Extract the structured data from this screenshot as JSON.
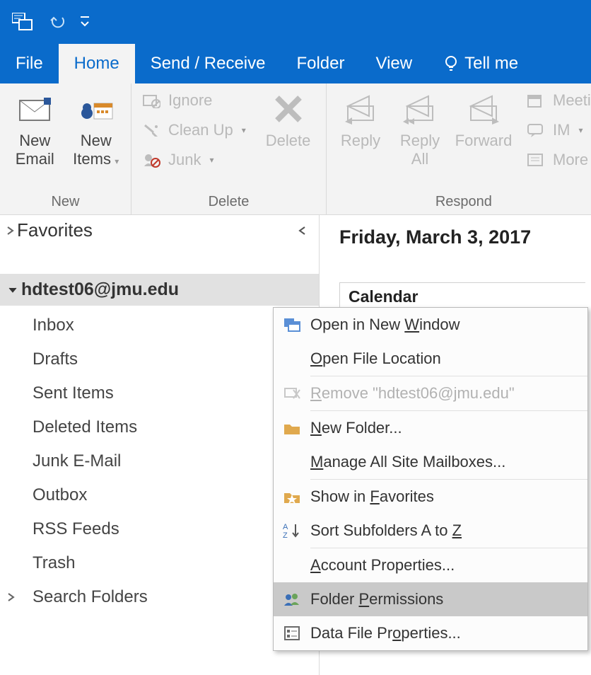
{
  "tabs": {
    "file": "File",
    "home": "Home",
    "sendreceive": "Send / Receive",
    "folder": "Folder",
    "view": "View",
    "tellme": "Tell me"
  },
  "ribbon": {
    "groups": {
      "new": {
        "label": "New",
        "new_email": "New\nEmail",
        "new_items": "New\nItems"
      },
      "delete": {
        "label": "Delete",
        "ignore": "Ignore",
        "clean_up": "Clean Up",
        "junk": "Junk",
        "delete": "Delete"
      },
      "respond": {
        "label": "Respond",
        "reply": "Reply",
        "reply_all": "Reply\nAll",
        "forward": "Forward",
        "meeting": "Meeti",
        "im": "IM",
        "more": "More"
      }
    }
  },
  "nav": {
    "favorites": "Favorites",
    "account": "hdtest06@jmu.edu",
    "folders": [
      "Inbox",
      "Drafts",
      "Sent Items",
      "Deleted Items",
      "Junk E-Mail",
      "Outbox",
      "RSS Feeds",
      "Trash"
    ],
    "search_folders": "Search Folders"
  },
  "content": {
    "date": "Friday, March 3, 2017",
    "calendar": "Calendar"
  },
  "context_menu": {
    "open_new_window": {
      "pre": "Open in New ",
      "u": "W",
      "post": "indow"
    },
    "open_file_location": {
      "pre": "",
      "u": "O",
      "post": "pen File Location"
    },
    "remove_account": {
      "pre": "",
      "u": "R",
      "post": "emove \"hdtest06@jmu.edu\""
    },
    "new_folder": {
      "pre": "",
      "u": "N",
      "post": "ew Folder..."
    },
    "manage_mailboxes": {
      "pre": "",
      "u": "M",
      "post": "anage All Site Mailboxes..."
    },
    "show_favorites": {
      "pre": "Show in ",
      "u": "F",
      "post": "avorites"
    },
    "sort_subfolders": {
      "pre": "Sort Subfolders A to ",
      "u": "Z",
      "post": ""
    },
    "account_properties": {
      "pre": "",
      "u": "A",
      "post": "ccount Properties..."
    },
    "folder_permissions": {
      "pre": "Folder ",
      "u": "P",
      "post": "ermissions"
    },
    "data_file_properties": {
      "pre": "Data File Pr",
      "u": "o",
      "post": "perties..."
    }
  }
}
